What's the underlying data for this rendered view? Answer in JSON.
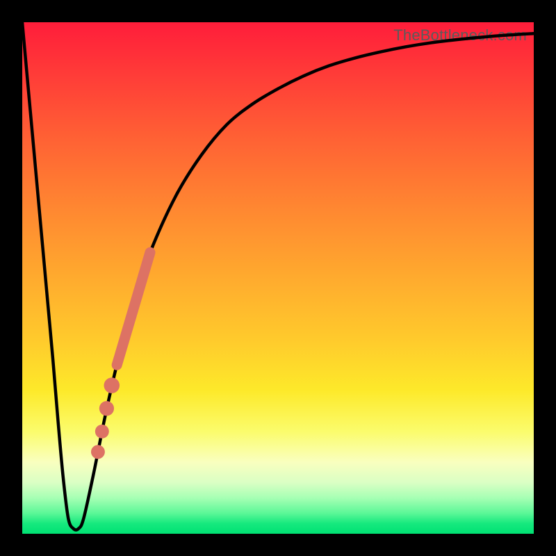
{
  "watermark": "TheBottleneck.com",
  "chart_data": {
    "type": "line",
    "title": "",
    "xlabel": "",
    "ylabel": "",
    "xlim": [
      0,
      100
    ],
    "ylim": [
      0,
      100
    ],
    "grid": false,
    "legend": false,
    "background": "red-yellow-green vertical gradient",
    "series": [
      {
        "name": "bottleneck-curve",
        "color": "#000000",
        "x": [
          0,
          2,
          4,
          5,
          6,
          7,
          8,
          9,
          10,
          11,
          12,
          14,
          16,
          18,
          20,
          22,
          25,
          30,
          35,
          40,
          45,
          50,
          55,
          60,
          65,
          70,
          75,
          80,
          85,
          90,
          95,
          100
        ],
        "y": [
          100,
          78,
          56,
          45,
          34,
          22,
          11,
          3,
          1,
          1,
          3,
          12,
          22,
          31,
          39,
          46,
          55,
          66,
          74,
          80,
          84,
          87,
          89.5,
          91.5,
          93,
          94.2,
          95.2,
          96,
          96.6,
          97.1,
          97.5,
          97.8
        ]
      }
    ],
    "markers": [
      {
        "name": "highlight-segment",
        "shape": "thick-line",
        "color": "#dd7264",
        "x1": 18.5,
        "y1": 33,
        "x2": 25,
        "y2": 55
      },
      {
        "name": "dot-1",
        "shape": "circle",
        "color": "#dd7264",
        "x": 17.5,
        "y": 29,
        "r": 1.1
      },
      {
        "name": "dot-2",
        "shape": "circle",
        "color": "#dd7264",
        "x": 16.5,
        "y": 24.5,
        "r": 1.0
      },
      {
        "name": "dot-3",
        "shape": "circle",
        "color": "#dd7264",
        "x": 15.6,
        "y": 20,
        "r": 0.9
      },
      {
        "name": "dot-4",
        "shape": "circle",
        "color": "#dd7264",
        "x": 14.8,
        "y": 16,
        "r": 0.9
      }
    ]
  }
}
